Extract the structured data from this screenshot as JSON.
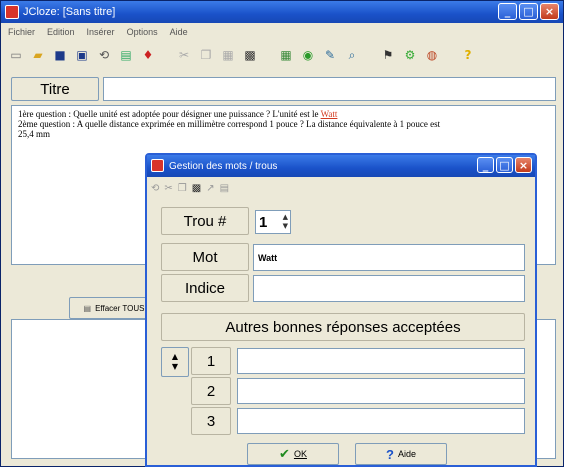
{
  "window": {
    "title": "JCloze: [Sans titre]",
    "buttons": {
      "minimize": "_",
      "maximize": "□",
      "close": "×"
    }
  },
  "menu": [
    "Fichier",
    "Edition",
    "Insérer",
    "Options",
    "Aide"
  ],
  "toolbar": {
    "icons": [
      "new-icon",
      "open-icon",
      "save-icon",
      "save-as-icon",
      "undo-icon",
      "clear-icon",
      "gap-icon",
      "cut-icon",
      "copy-icon",
      "paste-icon",
      "find-icon",
      "export-icon",
      "web-icon",
      "print-icon",
      "help-icon"
    ]
  },
  "title_section": {
    "label": "Titre",
    "value": ""
  },
  "exercise_text": {
    "line1_prefix": "1ère question : Quelle unité est adoptée pour désigner une puissance ? L'unité est le",
    "line1_gap": "Watt",
    "line2": "2ème question : A quelle distance exprimée en millimètre correspond 1 pouce ? La distance équivalente à 1 pouce est",
    "line3": "25,4  mm"
  },
  "bottom_button": {
    "label": "Effacer TOUS"
  },
  "dialog": {
    "title": "Gestion des mots / trous",
    "gap_number_label": "Trou #",
    "gap_number_value": "1",
    "word_label": "Mot",
    "word_value": "Watt",
    "clue_label": "Indice",
    "clue_value": "",
    "alternates_header": "Autres bonnes réponses acceptées",
    "alternates": [
      {
        "index": "1",
        "value": ""
      },
      {
        "index": "2",
        "value": ""
      },
      {
        "index": "3",
        "value": ""
      }
    ],
    "ok_label": "OK",
    "help_label": "Aide"
  },
  "colors": {
    "titlebar": "#1a52c9",
    "gap_text": "#d23a1f",
    "ok_check": "#1f8a1f",
    "help_mark": "#1a52c9"
  }
}
